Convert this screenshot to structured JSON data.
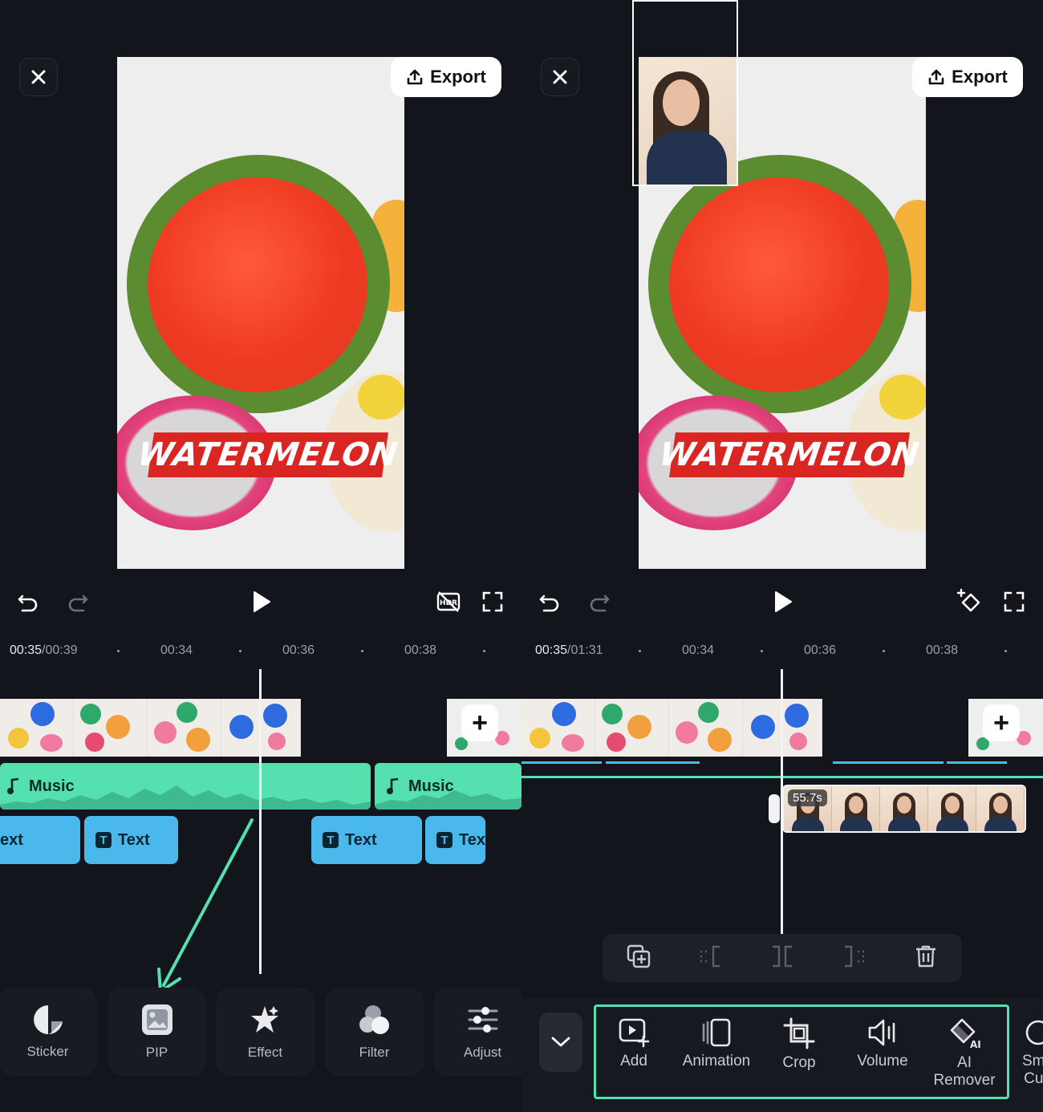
{
  "left": {
    "export_label": "Export",
    "watermelon_text": "WATERMELON",
    "time_current": "00:35",
    "time_total": "/00:39",
    "ticks": [
      "00:34",
      "00:36",
      "00:38"
    ],
    "music_label_1": "Music",
    "music_label_2": "Music",
    "text_clips": [
      "ext",
      "Text",
      "Text",
      "Tex"
    ],
    "tools": [
      {
        "label": "Sticker",
        "icon": "sticker-icon"
      },
      {
        "label": "PIP",
        "icon": "pip-icon"
      },
      {
        "label": "Effect",
        "icon": "effect-icon"
      },
      {
        "label": "Filter",
        "icon": "filter-icon"
      },
      {
        "label": "Adjust",
        "icon": "adjust-icon"
      }
    ]
  },
  "right": {
    "export_label": "Export",
    "watermelon_text": "WATERMELON",
    "time_current": "00:35",
    "time_total": "/01:31",
    "ticks": [
      "00:34",
      "00:36",
      "00:38"
    ],
    "pip_duration": "55.7s",
    "tools": [
      {
        "label": "Add",
        "icon": "add-video-icon"
      },
      {
        "label": "Animation",
        "icon": "animation-icon"
      },
      {
        "label": "Crop",
        "icon": "crop-icon"
      },
      {
        "label": "Volume",
        "icon": "volume-icon"
      },
      {
        "label": "AI",
        "label2": "Remover",
        "icon": "ai-remover-icon"
      },
      {
        "label": "Sm",
        "label2": "Cu",
        "icon": "smart-cutout-icon"
      }
    ]
  },
  "colors": {
    "accent_green": "#55e0b0",
    "text_clip_blue": "#4bb8ec",
    "background": "#12151b"
  }
}
